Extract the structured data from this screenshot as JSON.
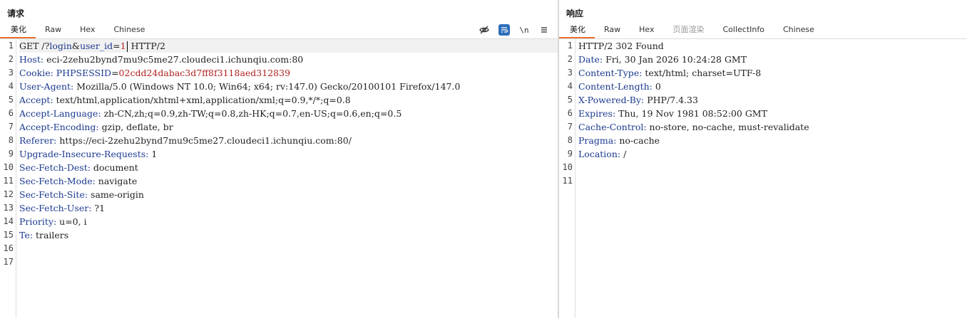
{
  "request": {
    "title": "请求",
    "tabs": [
      "美化",
      "Raw",
      "Hex",
      "Chinese"
    ],
    "active_tab": "美化",
    "tool_icons": [
      "eye-off-icon",
      "wrap-icon",
      "newline-icon",
      "menu-icon"
    ],
    "newline_label": "\\n",
    "request_line": {
      "method": "GET /?",
      "p1": "login",
      "amp": "&",
      "p2": "user_id",
      "eq": "=",
      "v2": "1",
      "proto": " HTTP/2"
    },
    "cookie": {
      "name": "Cookie: ",
      "k": "PHPSESSID",
      "eq": "=",
      "v": "02cdd24dabac3d7ff8f3118aed312839"
    },
    "headers": [
      {
        "n": 2,
        "name": "Host",
        "value": "eci-2zehu2bynd7mu9c5me27.cloudeci1.ichunqiu.com:80"
      },
      {
        "n": 4,
        "name": "User-Agent",
        "value": "Mozilla/5.0 (Windows NT 10.0; Win64; x64; rv:147.0) Gecko/20100101 Firefox/147.0"
      },
      {
        "n": 5,
        "name": "Accept",
        "value": "text/html,application/xhtml+xml,application/xml;q=0.9,*/*;q=0.8"
      },
      {
        "n": 6,
        "name": "Accept-Language",
        "value": "zh-CN,zh;q=0.9,zh-TW;q=0.8,zh-HK;q=0.7,en-US;q=0.6,en;q=0.5"
      },
      {
        "n": 7,
        "name": "Accept-Encoding",
        "value": "gzip, deflate, br"
      },
      {
        "n": 8,
        "name": "Referer",
        "value": "https://eci-2zehu2bynd7mu9c5me27.cloudeci1.ichunqiu.com:80/"
      },
      {
        "n": 9,
        "name": "Upgrade-Insecure-Requests",
        "value": "1"
      },
      {
        "n": 10,
        "name": "Sec-Fetch-Dest",
        "value": "document"
      },
      {
        "n": 11,
        "name": "Sec-Fetch-Mode",
        "value": "navigate"
      },
      {
        "n": 12,
        "name": "Sec-Fetch-Site",
        "value": "same-origin"
      },
      {
        "n": 13,
        "name": "Sec-Fetch-User",
        "value": "?1"
      },
      {
        "n": 14,
        "name": "Priority",
        "value": "u=0, i"
      },
      {
        "n": 15,
        "name": "Te",
        "value": "trailers"
      }
    ],
    "line_count": 17
  },
  "response": {
    "title": "响应",
    "tabs": [
      "美化",
      "Raw",
      "Hex",
      "页面渲染",
      "CollectInfo",
      "Chinese"
    ],
    "active_tab": "美化",
    "disabled_tab": "页面渲染",
    "status_line": "HTTP/2 302 Found",
    "headers": [
      {
        "n": 2,
        "name": "Date",
        "value": "Fri, 30 Jan 2026 10:24:28 GMT"
      },
      {
        "n": 3,
        "name": "Content-Type",
        "value": "text/html; charset=UTF-8"
      },
      {
        "n": 4,
        "name": "Content-Length",
        "value": "0"
      },
      {
        "n": 5,
        "name": "X-Powered-By",
        "value": "PHP/7.4.33"
      },
      {
        "n": 6,
        "name": "Expires",
        "value": "Thu, 19 Nov 1981 08:52:00 GMT"
      },
      {
        "n": 7,
        "name": "Cache-Control",
        "value": "no-store, no-cache, must-revalidate"
      },
      {
        "n": 8,
        "name": "Pragma",
        "value": "no-cache"
      },
      {
        "n": 9,
        "name": "Location",
        "value": "/"
      }
    ],
    "line_count": 11
  },
  "colors": {
    "accent": "#e8712b",
    "header_name": "#1c3a8f",
    "cookie_value": "#b22222",
    "toggle_on": "#2d6fba"
  }
}
